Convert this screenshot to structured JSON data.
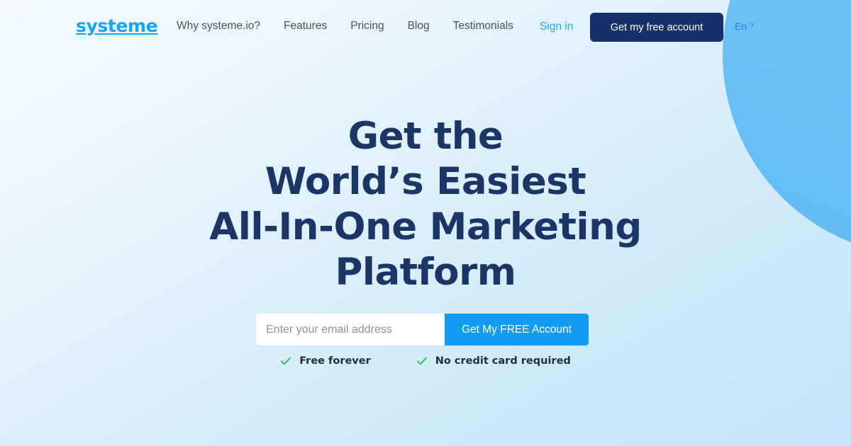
{
  "brand": {
    "logo_text": "systeme",
    "logo_color": "#16a6f5"
  },
  "header": {
    "nav_links": [
      {
        "label": "Why systeme.io?",
        "name": "nav-why-systeme"
      },
      {
        "label": "Features",
        "name": "nav-features"
      },
      {
        "label": "Pricing",
        "name": "nav-pricing"
      },
      {
        "label": "Blog",
        "name": "nav-blog"
      },
      {
        "label": "Testimonials",
        "name": "nav-testimonials"
      }
    ],
    "sign_in_label": "Sign in",
    "cta_label": "Get my free account",
    "cta_color": "#15306b",
    "language": {
      "selected": "En",
      "chevron": "˅"
    }
  },
  "hero": {
    "headline_lines": [
      "Get the",
      "World’s Easiest",
      "All-In-One Marketing",
      "Platform"
    ],
    "headline_color": "#1b3566"
  },
  "signup": {
    "email_placeholder": "Enter your email address",
    "email_value": "",
    "submit_label": "Get My FREE Account",
    "submit_color": "#119bf3"
  },
  "features": [
    {
      "label": "Free forever",
      "icon": "check-icon"
    },
    {
      "label": "No credit card required",
      "icon": "check-icon"
    }
  ],
  "theme": {
    "check_color": "#3bbf5c",
    "background_start": "#f4fafe",
    "background_end": "#c4e5f8",
    "circle_color": "#6bc1f5",
    "accent_blue": "#2aa6f0"
  }
}
